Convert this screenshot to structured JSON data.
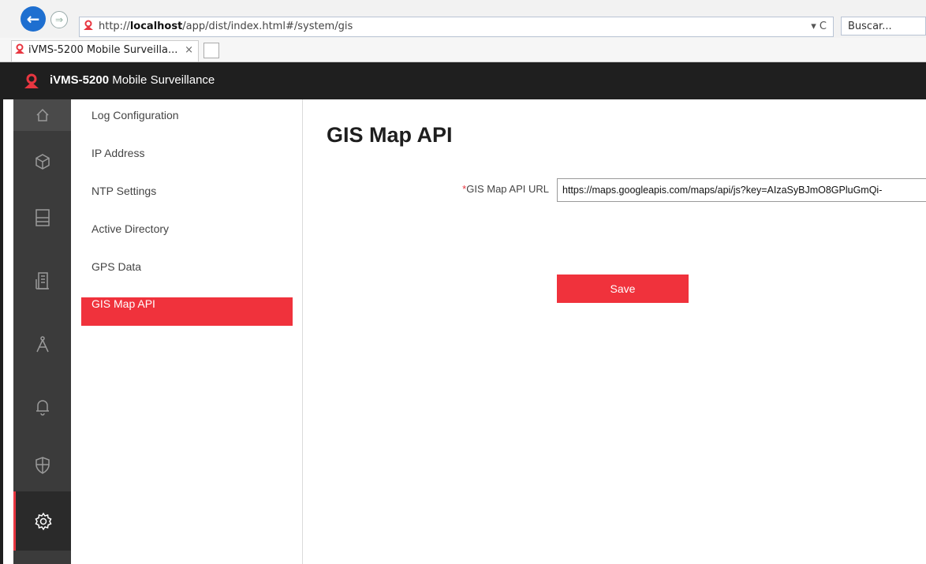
{
  "browser": {
    "url_prefix": "http://",
    "url_host": "localhost",
    "url_path": "/app/dist/index.html#/system/gis",
    "refresh_icon": "▾ C",
    "search_placeholder": "Buscar...",
    "tab_title": "iVMS-5200 Mobile Surveilla...",
    "tab_close": "×"
  },
  "app": {
    "title_bold": "iVMS-5200",
    "title_rest": " Mobile Surveillance",
    "brand_color": "#e83640"
  },
  "rail": {
    "icons": [
      "home-icon",
      "cube-icon",
      "server-icon",
      "building-icon",
      "compass-icon",
      "bell-icon",
      "shield-icon",
      "gear-icon"
    ],
    "active": "gear-icon"
  },
  "submenu": {
    "items": [
      {
        "label": "Log Configuration"
      },
      {
        "label": "IP Address"
      },
      {
        "label": "NTP Settings"
      },
      {
        "label": "Active Directory"
      },
      {
        "label": "GPS Data"
      },
      {
        "label": "GIS Map API"
      }
    ],
    "selected": "GIS Map API"
  },
  "content": {
    "title": "GIS Map API",
    "field_required_mark": "*",
    "field_label": "GIS Map API URL",
    "field_value": "https://maps.googleapis.com/maps/api/js?key=AIzaSyBJmO8GPluGmQi-",
    "save_label": "Save"
  }
}
